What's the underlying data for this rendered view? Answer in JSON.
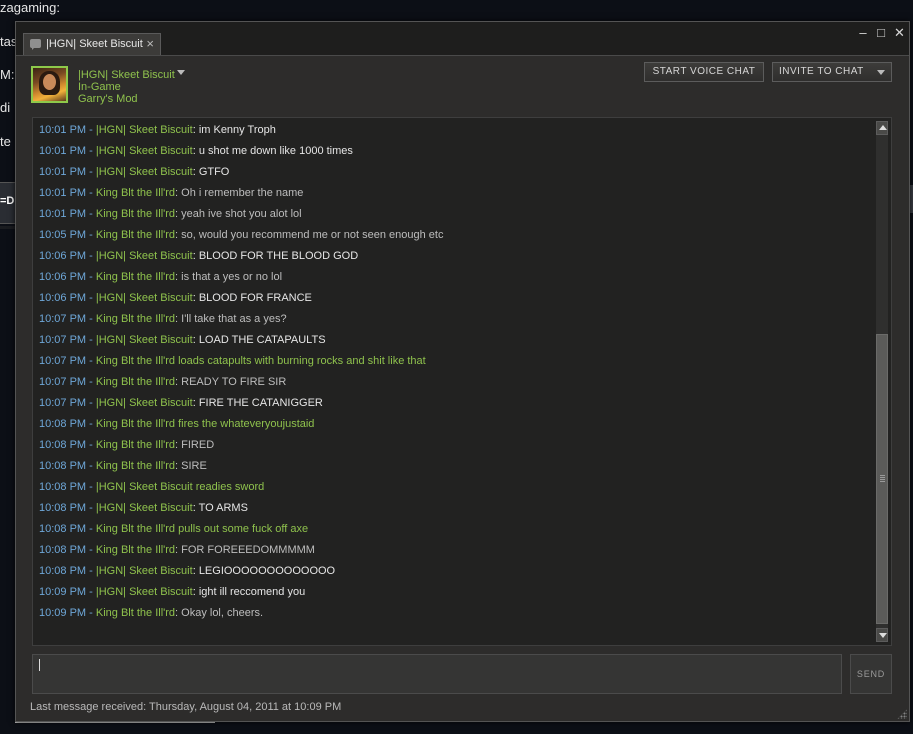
{
  "background": {
    "fragments": [
      "zagaming:",
      "tas",
      "M:",
      "di",
      "te"
    ],
    "bar_label": "=DI"
  },
  "window": {
    "tab_label": "|HGN| Skeet Biscuit",
    "tab_close": "×",
    "controls": {
      "minimize": "–",
      "maximize": "□",
      "close": "✕"
    }
  },
  "friend": {
    "name": "|HGN| Skeet Biscuit",
    "status": "In-Game",
    "game": "Garry's Mod"
  },
  "actions": {
    "voice_label": "START VOICE CHAT",
    "invite_label": "INVITE TO CHAT",
    "send_label": "SEND"
  },
  "input": {
    "value": ""
  },
  "messages": [
    {
      "time": "10:01 PM",
      "name": "|HGN| Skeet Biscuit",
      "text": "im Kenny Troph",
      "kind": "friend"
    },
    {
      "time": "10:01 PM",
      "name": "|HGN| Skeet Biscuit",
      "text": "u shot me down like 1000 times",
      "kind": "friend"
    },
    {
      "time": "10:01 PM",
      "name": "|HGN| Skeet Biscuit",
      "text": "GTFO",
      "kind": "friend"
    },
    {
      "time": "10:01 PM",
      "name": "King Blt the Ill'rd",
      "text": "Oh i remember the name",
      "kind": "self"
    },
    {
      "time": "10:01 PM",
      "name": "King Blt the Ill'rd",
      "text": "yeah ive shot you alot lol",
      "kind": "self"
    },
    {
      "time": "10:05 PM",
      "name": "King Blt the Ill'rd",
      "text": "so, would you recommend me or not seen enough etc",
      "kind": "self"
    },
    {
      "time": "10:06 PM",
      "name": "|HGN| Skeet Biscuit",
      "text": "BLOOD FOR THE BLOOD GOD",
      "kind": "friend"
    },
    {
      "time": "10:06 PM",
      "name": "King Blt the Ill'rd",
      "text": "is that a yes or no lol",
      "kind": "self"
    },
    {
      "time": "10:06 PM",
      "name": "|HGN| Skeet Biscuit",
      "text": "BLOOD FOR FRANCE",
      "kind": "friend"
    },
    {
      "time": "10:07 PM",
      "name": "King Blt the Ill'rd",
      "text": "I'll take that as a yes?",
      "kind": "self"
    },
    {
      "time": "10:07 PM",
      "name": "|HGN| Skeet Biscuit",
      "text": "LOAD THE CATAPAULTS",
      "kind": "friend"
    },
    {
      "time": "10:07 PM",
      "name": "King Blt the Ill'rd",
      "text": "loads catapults with burning rocks and shit like that",
      "kind": "emote"
    },
    {
      "time": "10:07 PM",
      "name": "King Blt the Ill'rd",
      "text": "READY TO FIRE SIR",
      "kind": "self"
    },
    {
      "time": "10:07 PM",
      "name": "|HGN| Skeet Biscuit",
      "text": "FIRE THE CATANIGGER",
      "kind": "friend"
    },
    {
      "time": "10:08 PM",
      "name": "King Blt the Ill'rd",
      "text": "fires the whateveryoujustaid",
      "kind": "emote"
    },
    {
      "time": "10:08 PM",
      "name": "King Blt the Ill'rd",
      "text": "FIRED",
      "kind": "self"
    },
    {
      "time": "10:08 PM",
      "name": "King Blt the Ill'rd",
      "text": "SIRE",
      "kind": "self"
    },
    {
      "time": "10:08 PM",
      "name": "|HGN| Skeet Biscuit",
      "text": "readies sword",
      "kind": "emote"
    },
    {
      "time": "10:08 PM",
      "name": "|HGN| Skeet Biscuit",
      "text": "TO ARMS",
      "kind": "friend"
    },
    {
      "time": "10:08 PM",
      "name": "King Blt the Ill'rd",
      "text": "pulls out some fuck off axe",
      "kind": "emote"
    },
    {
      "time": "10:08 PM",
      "name": "King Blt the Ill'rd",
      "text": "FOR FOREEEDOMMMMM",
      "kind": "self"
    },
    {
      "time": "10:08 PM",
      "name": "|HGN| Skeet Biscuit",
      "text": "LEGIOOOOOOOOOOOOO",
      "kind": "friend"
    },
    {
      "time": "10:09 PM",
      "name": "|HGN| Skeet Biscuit",
      "text": "ight ill reccomend you",
      "kind": "friend"
    },
    {
      "time": "10:09 PM",
      "name": "King Blt the Ill'rd",
      "text": "Okay lol, cheers.",
      "kind": "self"
    }
  ],
  "footer": {
    "last_message": "Last message received: Thursday, August 04, 2011 at 10:09 PM"
  },
  "colors": {
    "timestamp": "#6ea7d8",
    "friend_name": "#8fc24d",
    "friend_text": "#e6e6e6",
    "self_text": "#bdbdbd",
    "emote": "#8fc24d"
  },
  "icons": [
    "chat-icon",
    "close-icon",
    "minimize-icon",
    "maximize-icon",
    "chevron-down-icon",
    "scroll-up-icon",
    "scroll-down-icon",
    "resize-grip-icon"
  ]
}
